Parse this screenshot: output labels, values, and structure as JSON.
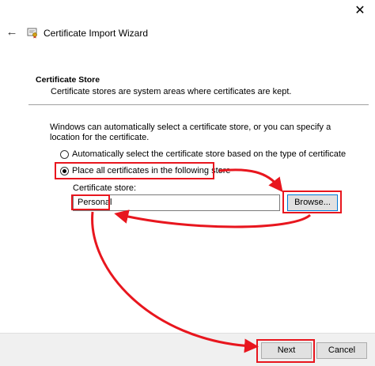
{
  "window": {
    "close_glyph": "✕",
    "back_glyph": "←",
    "title": "Certificate Import Wizard",
    "icon": "certificate-wizard-icon"
  },
  "section": {
    "heading": "Certificate Store",
    "description": "Certificate stores are system areas where certificates are kept."
  },
  "intro": "Windows can automatically select a certificate store, or you can specify a location for the certificate.",
  "options": [
    {
      "label": "Automatically select the certificate store based on the type of certificate",
      "selected": false
    },
    {
      "label": "Place all certificates in the following store",
      "selected": true
    }
  ],
  "store": {
    "label": "Certificate store:",
    "value": "Personal",
    "browse_label": "Browse..."
  },
  "footer": {
    "next_label": "Next",
    "cancel_label": "Cancel"
  },
  "annotation_color": "#e8161e"
}
